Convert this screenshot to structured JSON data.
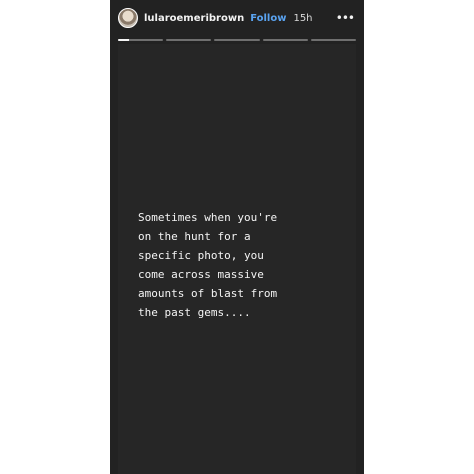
{
  "story": {
    "header": {
      "username": "lularoemeribrown",
      "follow_label": "Follow",
      "timestamp": "15h",
      "more_icon": "•••",
      "avatar_icon": "profile-avatar"
    },
    "progress": {
      "segments": 5,
      "active_index": 0,
      "active_fill": 0.25
    },
    "caption": "Sometimes when you're\non the hunt for a\nspecific photo, you\ncome across massive\namounts of blast from\nthe past gems...."
  },
  "colors": {
    "background": "#222222",
    "text": "#f4f4f4",
    "follow": "#5aa3f0"
  }
}
